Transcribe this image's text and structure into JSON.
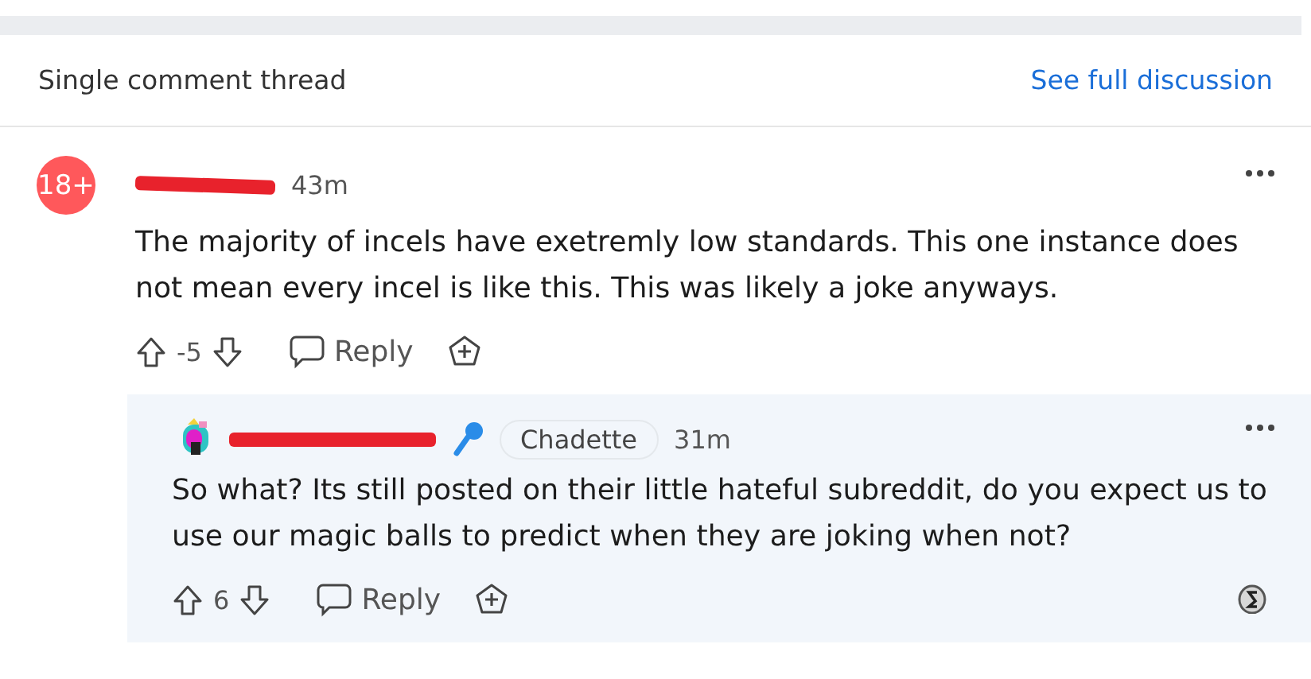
{
  "header": {
    "title": "Single comment thread",
    "link": "See full discussion"
  },
  "comments": [
    {
      "avatar": {
        "kind": "nsfw",
        "label": "18+"
      },
      "username_redacted": true,
      "time": "43m",
      "mic": false,
      "body": "The majority of incels have exetremly low standards. This one instance does not mean every incel is like this. This was likely a joke anyways.",
      "score": "-5",
      "reply": "Reply",
      "award_badge": false
    },
    {
      "username_redacted": true,
      "time": "31m",
      "flair": "Chadette",
      "mic": true,
      "body": "So what? Its still posted on their little hateful subreddit, do you expect us to use our magic balls to predict when they are joking when not?",
      "score": "6",
      "reply": "Reply",
      "award_badge": true
    }
  ]
}
